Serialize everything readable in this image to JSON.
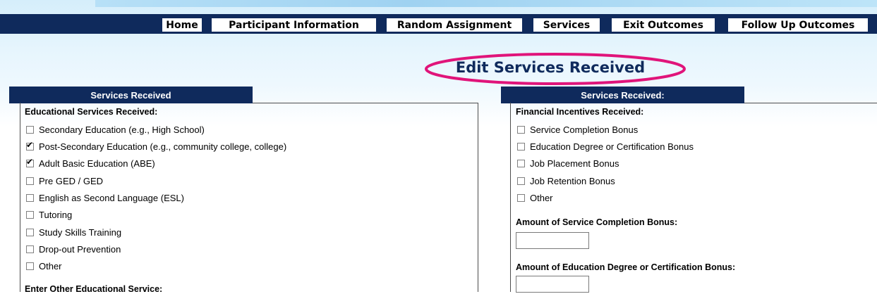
{
  "nav": {
    "items": [
      {
        "label": "Home"
      },
      {
        "label": "Participant Information"
      },
      {
        "label": "Random Assignment"
      },
      {
        "label": "Services"
      },
      {
        "label": "Exit Outcomes"
      },
      {
        "label": "Follow Up Outcomes"
      }
    ]
  },
  "page": {
    "title": "Edit Services Received",
    "highlight_color": "#e0147a"
  },
  "left_panel": {
    "header": "Services Received",
    "section_label": "Educational Services Received:",
    "options": [
      {
        "label": "Secondary Education (e.g., High School)",
        "checked": false
      },
      {
        "label": "Post-Secondary Education (e.g., community college, college)",
        "checked": true
      },
      {
        "label": "Adult Basic Education (ABE)",
        "checked": true
      },
      {
        "label": "Pre GED / GED",
        "checked": false
      },
      {
        "label": "English as Second Language (ESL)",
        "checked": false
      },
      {
        "label": "Tutoring",
        "checked": false
      },
      {
        "label": "Study Skills Training",
        "checked": false
      },
      {
        "label": "Drop-out Prevention",
        "checked": false
      },
      {
        "label": "Other",
        "checked": false
      }
    ],
    "other_label": "Enter Other Educational Service:"
  },
  "right_panel": {
    "header": "Services Received:",
    "section_label": "Financial Incentives Received:",
    "options": [
      {
        "label": "Service Completion Bonus",
        "checked": false
      },
      {
        "label": "Education Degree or Certification Bonus",
        "checked": false
      },
      {
        "label": "Job Placement Bonus",
        "checked": false
      },
      {
        "label": "Job Retention Bonus",
        "checked": false
      },
      {
        "label": "Other",
        "checked": false
      }
    ],
    "amount_service_label": "Amount of Service Completion Bonus:",
    "amount_service_value": "",
    "amount_education_label": "Amount of Education Degree or Certification Bonus:",
    "amount_education_value": ""
  },
  "colors": {
    "navy": "#0f2a5c",
    "highlight": "#e0147a"
  }
}
